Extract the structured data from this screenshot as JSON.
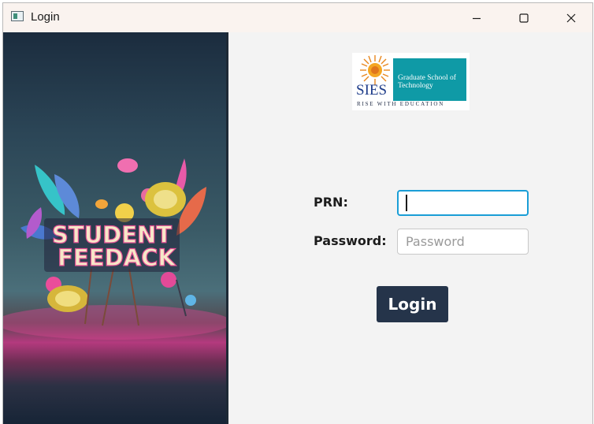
{
  "window": {
    "title": "Login",
    "controls": [
      "minimize-icon",
      "maximize-icon",
      "close-icon"
    ]
  },
  "illustration": {
    "text_line1": "STUDENT",
    "text_line2": "FEEDACK"
  },
  "logo": {
    "brand": "SIES",
    "institution_line1": "Graduate School of",
    "institution_line2": "Technology",
    "tagline": "RISE WITH EDUCATION",
    "accent_color": "#0f9aa6"
  },
  "form": {
    "prn_label": "PRN:",
    "prn_value": "",
    "prn_placeholder": "",
    "password_label": "Password:",
    "password_value": "",
    "password_placeholder": "Password",
    "login_label": "Login",
    "button_color": "#25344a",
    "focus_color": "#1a9ed6"
  }
}
